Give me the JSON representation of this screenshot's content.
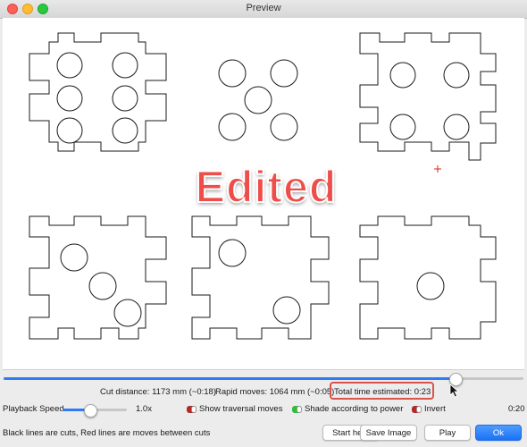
{
  "window": {
    "title": "Preview"
  },
  "overlay": {
    "stamp_text": "Edited"
  },
  "stats": {
    "cut_distance": "Cut distance: 1173 mm (~0:18)",
    "rapid_moves": "Rapid moves: 1064 mm (~0:05)",
    "total_time": "Total time estimated: 0:23"
  },
  "progress": {
    "fraction": 0.87
  },
  "playback": {
    "label": "Playback Speed",
    "speed": "1.0x",
    "speed_fraction": 0.43,
    "elapsed": "0:20"
  },
  "options": {
    "show_traversal": "Show traversal moves",
    "shade_power": "Shade according to power",
    "invert": "Invert"
  },
  "footer": {
    "hint": "Black lines are cuts, Red lines are moves between cuts"
  },
  "buttons": {
    "start_here": "Start here",
    "save_image": "Save Image",
    "play": "Play",
    "ok": "Ok"
  },
  "colors": {
    "accent": "#2f7bf5",
    "cut_line": "#1a1a1a",
    "move_line": "#e02020",
    "highlight": "#d9534f"
  },
  "icons": {
    "cursor": "mouse-pointer-icon"
  }
}
